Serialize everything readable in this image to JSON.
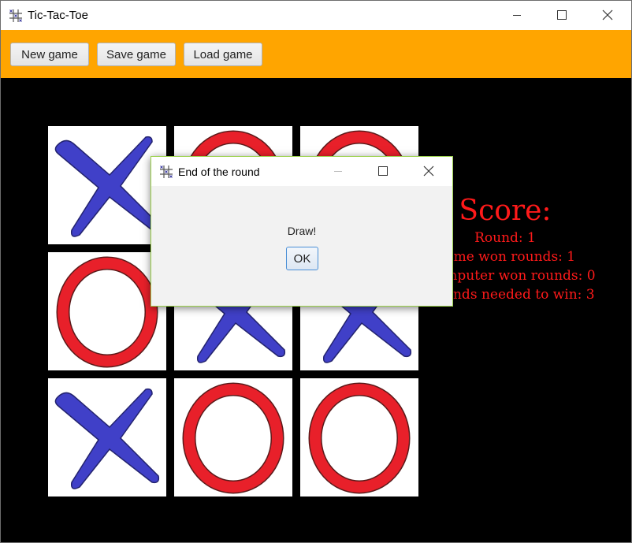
{
  "window": {
    "title": "Tic-Tac-Toe",
    "icon": "tic-tac-toe-app-icon",
    "controls": [
      "minimize-icon",
      "maximize-icon",
      "close-icon"
    ]
  },
  "toolbar": {
    "new_label": "New game",
    "save_label": "Save game",
    "load_label": "Load game",
    "background": "#ffa500"
  },
  "board": {
    "cells": [
      "X",
      "O",
      "O",
      "O",
      "X",
      "X",
      "X",
      "O",
      "O"
    ],
    "x_color": "#4040c8",
    "o_color": "#e8202a"
  },
  "score": {
    "title": "Score:",
    "round": "Round: 1",
    "game_won": "Game won rounds: 1",
    "computer_won": "Computer won rounds: 0",
    "rounds_needed": "Rounds needed to win: 3",
    "color": "#ff1a1a"
  },
  "dialog": {
    "title": "End of the round",
    "message": "Draw!",
    "ok_label": "OK"
  }
}
